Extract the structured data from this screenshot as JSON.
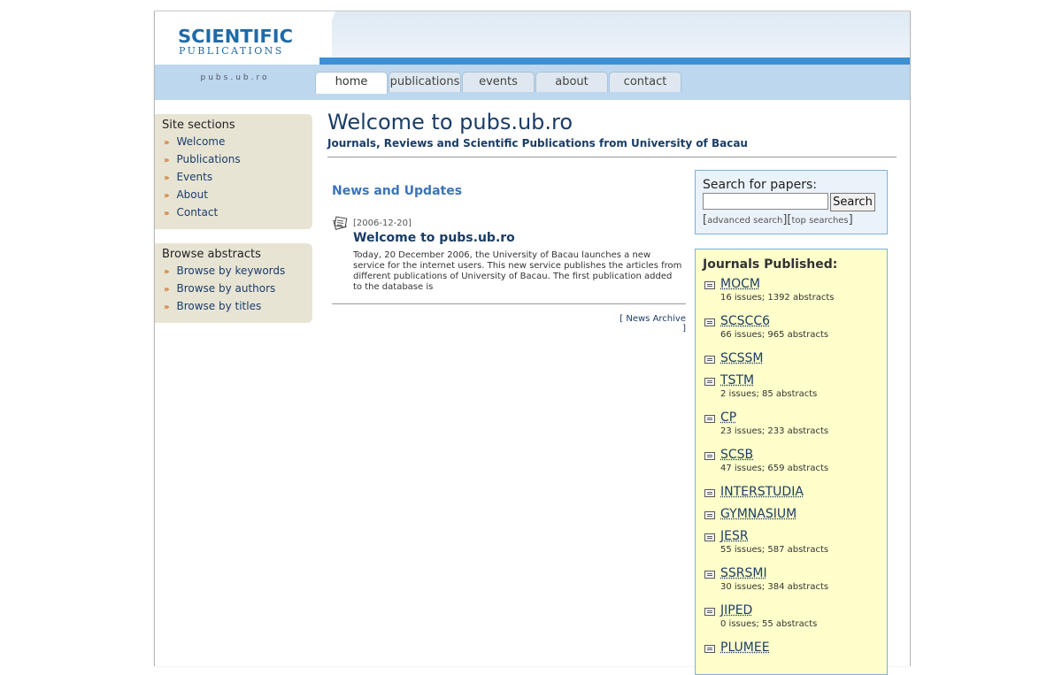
{
  "header": {
    "logo_main": "SCIENTIFIC",
    "logo_sub": "PUBLICATIONS",
    "site_url": "pubs.ub.ro",
    "tabs": [
      {
        "label": "home"
      },
      {
        "label": "publications"
      },
      {
        "label": "events"
      },
      {
        "label": "about"
      },
      {
        "label": "contact"
      }
    ]
  },
  "sidebar": {
    "site_sections": {
      "title": "Site sections",
      "items": [
        "Welcome",
        "Publications",
        "Events",
        "About",
        "Contact"
      ]
    },
    "browse_abstracts": {
      "title": "Browse abstracts",
      "items": [
        "Browse by keywords",
        "Browse by authors",
        "Browse by titles"
      ]
    },
    "bullet": "»"
  },
  "main": {
    "title": "Welcome to pubs.ub.ro",
    "subtitle": "Journals, Reviews and Scientific Publications from University of Bacau",
    "news": {
      "heading": "News and Updates",
      "date": "[2006-12-20]",
      "title": "Welcome to pubs.ub.ro",
      "body": "Today, 20 December 2006, the University of Bacau launches a new service for the internet users. This new service publishes the articles from different publications of University of Bacau. The first publication added to the database is",
      "archive_label": "News Archive",
      "archive_open": "[",
      "archive_close": "]"
    }
  },
  "search": {
    "label": "Search for papers:",
    "value": "",
    "button_label": "Search",
    "advanced_label": "advanced search",
    "top_label": "top searches",
    "open": "[",
    "close": "]"
  },
  "journals": {
    "heading": "Journals Published:",
    "items": [
      {
        "name": "MOCM",
        "stats": "16 issues; 1392 abstracts"
      },
      {
        "name": "SCSCC6",
        "stats": "66 issues; 965 abstracts"
      },
      {
        "name": "SCSSM",
        "stats": ""
      },
      {
        "name": "TSTM",
        "stats": "2 issues; 85 abstracts"
      },
      {
        "name": "CP",
        "stats": "23 issues; 233 abstracts"
      },
      {
        "name": "SCSB",
        "stats": "47 issues; 659 abstracts"
      },
      {
        "name": "INTERSTUDIA",
        "stats": ""
      },
      {
        "name": "GYMNASIUM",
        "stats": ""
      },
      {
        "name": "JESR",
        "stats": "55 issues; 587 abstracts"
      },
      {
        "name": "SSRSMI",
        "stats": "30 issues; 384 abstracts"
      },
      {
        "name": "JIPED",
        "stats": "0 issues; 55 abstracts"
      },
      {
        "name": "PLUMEE",
        "stats": ""
      }
    ]
  },
  "colors": {
    "brand_blue": "#1f6aa8",
    "nav_band": "#bcd7ee",
    "sidebar_bg": "#e8e4d4",
    "bullet_orange": "#d46a14",
    "journals_bg": "#ffffcc"
  }
}
